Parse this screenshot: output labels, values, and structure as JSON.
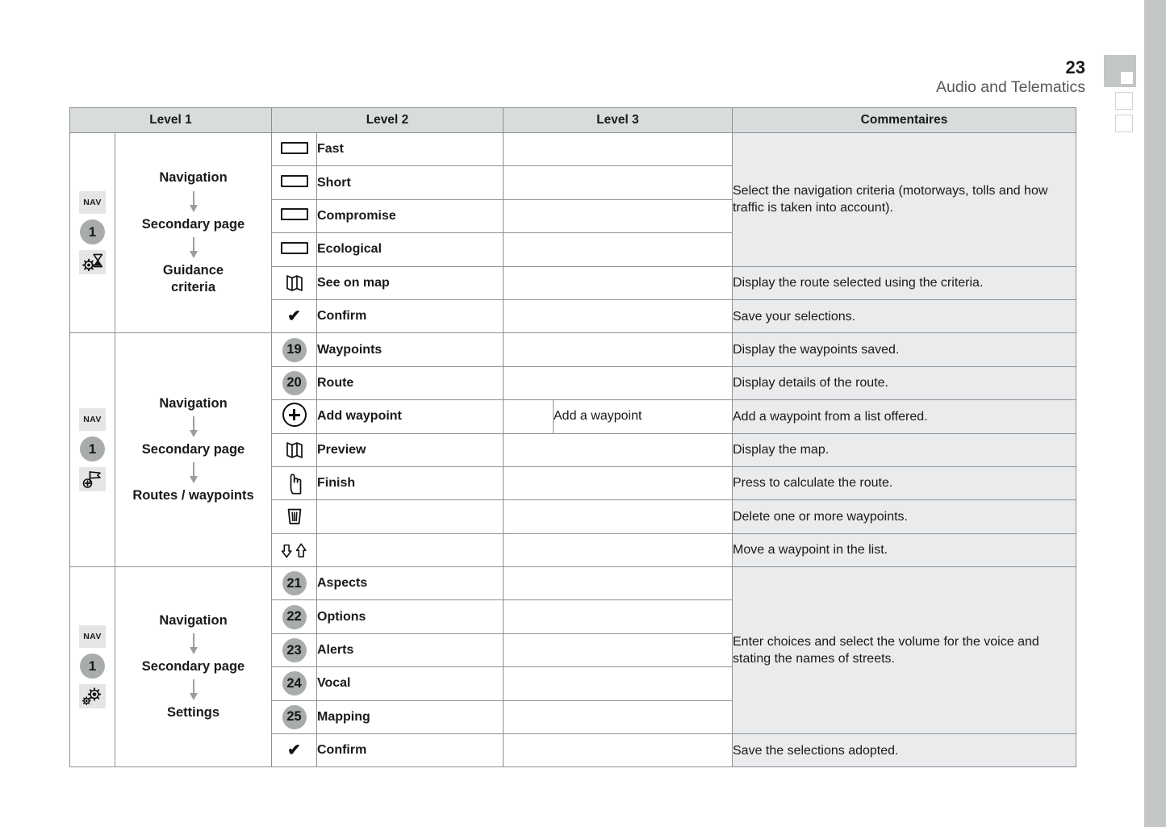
{
  "header": {
    "page_number": "23",
    "section_title": "Audio and Telematics"
  },
  "sidebar_markers": [
    {
      "name": "tab-marker-active",
      "state": "filled"
    },
    {
      "name": "tab-marker-2",
      "state": "empty"
    },
    {
      "name": "tab-marker-3",
      "state": "empty"
    }
  ],
  "table": {
    "columns": [
      "Level 1",
      "Level 2",
      "Level 3",
      "Commentaires"
    ],
    "sections": [
      {
        "id": "guidance-criteria",
        "icons": {
          "chip": "NAV",
          "number": "1",
          "glyph": "gear-hourglass-icon"
        },
        "path": [
          "Navigation",
          "Secondary page",
          "Guidance criteria"
        ],
        "path_lines": [
          "Navigation",
          "Secondary page",
          "Guidance",
          "criteria"
        ],
        "rows": [
          {
            "icon": "bar-icon",
            "level2": "Fast",
            "level3": "",
            "comment": ""
          },
          {
            "icon": "bar-icon",
            "level2": "Short",
            "level3": "",
            "comment": ""
          },
          {
            "icon": "bar-icon",
            "level2": "Compromise",
            "level3": "",
            "comment": ""
          },
          {
            "icon": "bar-icon",
            "level2": "Ecological",
            "level3": "",
            "comment": ""
          },
          {
            "icon": "map-icon",
            "level2": "See on map",
            "level3": "",
            "comment": "Display the route selected using the criteria."
          },
          {
            "icon": "check-icon",
            "level2": "Confirm",
            "level3": "",
            "comment": "Save your selections."
          }
        ],
        "merged_comment": "Select the navigation criteria (motorways, tolls and how traffic is taken into account)."
      },
      {
        "id": "routes-waypoints",
        "icons": {
          "chip": "NAV",
          "number": "1",
          "glyph": "flag-plus-icon"
        },
        "path": [
          "Navigation",
          "Secondary page",
          "Routes / waypoints"
        ],
        "path_lines": [
          "Navigation",
          "Secondary page",
          "Routes / waypoints"
        ],
        "rows": [
          {
            "icon": "badge-19",
            "level2": "Waypoints",
            "level3": "",
            "comment": "Display the waypoints saved."
          },
          {
            "icon": "badge-20",
            "level2": "Route",
            "level3": "",
            "comment": "Display details of the route."
          },
          {
            "icon": "plus-circle-icon",
            "level2": "Add waypoint",
            "level3": "Add a waypoint",
            "comment": "Add a waypoint from a list offered."
          },
          {
            "icon": "map-icon",
            "level2": "Preview",
            "level3": "",
            "comment": "Display the map."
          },
          {
            "icon": "hand-pointer-icon",
            "level2": "Finish",
            "level3": "",
            "comment": "Press to calculate the route."
          },
          {
            "icon": "trash-icon",
            "level2": "",
            "level3": "",
            "comment": "Delete one or more waypoints."
          },
          {
            "icon": "move-arrows-icon",
            "level2": "",
            "level3": "",
            "comment": "Move a waypoint in the list."
          }
        ]
      },
      {
        "id": "settings",
        "icons": {
          "chip": "NAV",
          "number": "1",
          "glyph": "gears-icon"
        },
        "path": [
          "Navigation",
          "Secondary page",
          "Settings"
        ],
        "path_lines": [
          "Navigation",
          "Secondary page",
          "Settings"
        ],
        "rows": [
          {
            "icon": "badge-21",
            "level2": "Aspects",
            "level3": "",
            "comment": ""
          },
          {
            "icon": "badge-22",
            "level2": "Options",
            "level3": "",
            "comment": ""
          },
          {
            "icon": "badge-23",
            "level2": "Alerts",
            "level3": "",
            "comment": ""
          },
          {
            "icon": "badge-24",
            "level2": "Vocal",
            "level3": "",
            "comment": ""
          },
          {
            "icon": "badge-25",
            "level2": "Mapping",
            "level3": "",
            "comment": ""
          },
          {
            "icon": "check-icon",
            "level2": "Confirm",
            "level3": "",
            "comment": "Save the selections adopted."
          }
        ],
        "merged_comment": "Enter choices and select the volume for the voice and stating the names of streets."
      }
    ]
  },
  "badges": {
    "b19": "19",
    "b20": "20",
    "b21": "21",
    "b22": "22",
    "b23": "23",
    "b24": "24",
    "b25": "25"
  },
  "colors": {
    "header_fill": "#d9dcdd",
    "comment_fill": "#eaebed",
    "badge_fill": "#a9acad",
    "chip_fill": "#e3e5e6",
    "border": "#8d9193",
    "edge_strip": "#c3c6c6"
  }
}
